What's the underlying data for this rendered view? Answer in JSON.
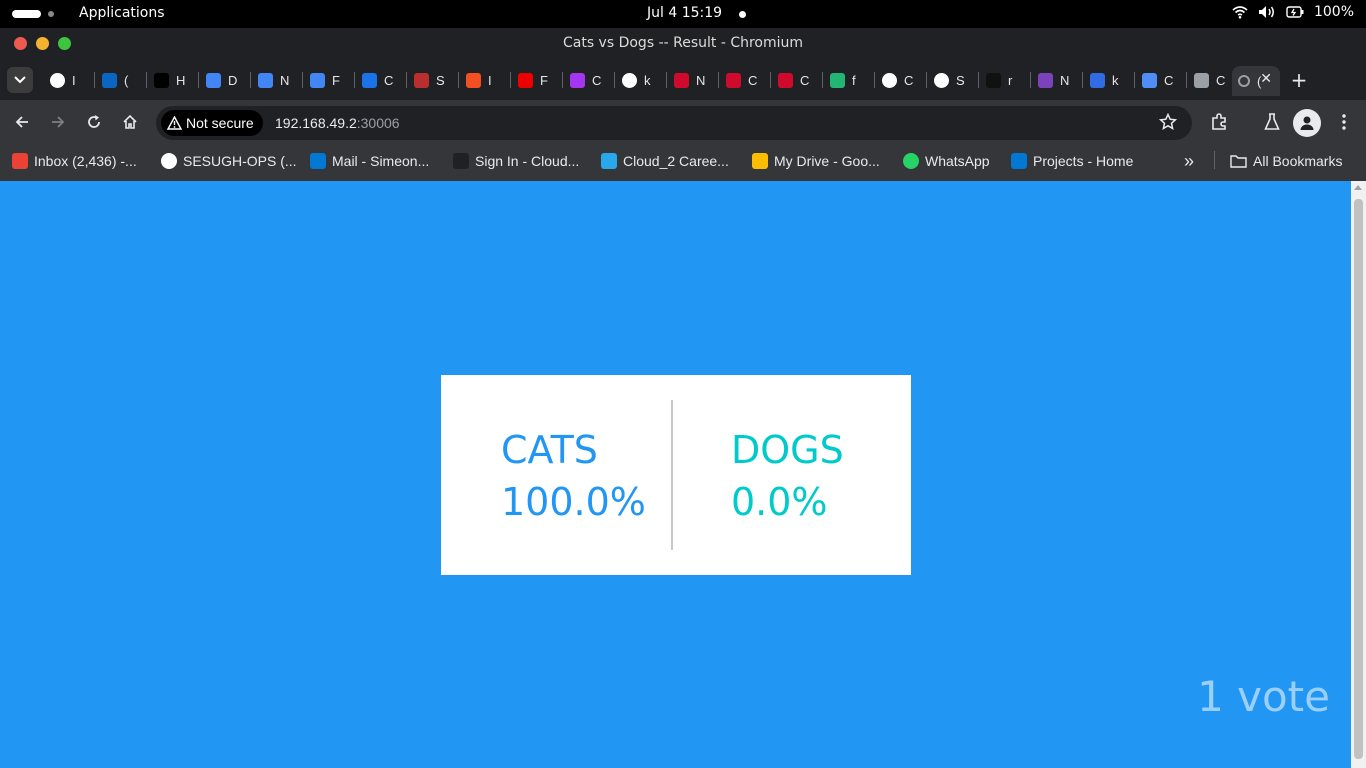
{
  "system_bar": {
    "activities_label": "Applications",
    "clock": "Jul 4  15:19",
    "battery": "100%"
  },
  "window": {
    "title": "Cats vs Dogs -- Result - Chromium"
  },
  "tabs": [
    {
      "label": "I",
      "icon": "gmail-icon",
      "color": "#ffffff"
    },
    {
      "label": "(",
      "icon": "linkedin-icon",
      "color": "#0a66c2"
    },
    {
      "label": "H",
      "icon": "x-icon",
      "color": "#000000"
    },
    {
      "label": "D",
      "icon": "google-docs-icon",
      "color": "#4285f4"
    },
    {
      "label": "N",
      "icon": "google-docs-icon",
      "color": "#4285f4"
    },
    {
      "label": "F",
      "icon": "google-docs-icon",
      "color": "#4285f4"
    },
    {
      "label": "C",
      "icon": "infinity-icon",
      "color": "#1a73e8"
    },
    {
      "label": "S",
      "icon": "scribd-icon",
      "color": "#b92e2e"
    },
    {
      "label": "I",
      "icon": "microsoft-icon",
      "color": "#f25022"
    },
    {
      "label": "F",
      "icon": "redhat-icon",
      "color": "#ee0000"
    },
    {
      "label": "C",
      "icon": "udemy-icon",
      "color": "#a435f0"
    },
    {
      "label": "k",
      "icon": "github-icon",
      "color": "#ffffff"
    },
    {
      "label": "N",
      "icon": "huawei-icon",
      "color": "#cf0a2c"
    },
    {
      "label": "C",
      "icon": "huawei-icon",
      "color": "#cf0a2c"
    },
    {
      "label": "C",
      "icon": "huawei-icon",
      "color": "#cf0a2c"
    },
    {
      "label": "f",
      "icon": "fi-icon",
      "color": "#22b573"
    },
    {
      "label": "C",
      "icon": "openai-icon",
      "color": "#ffffff"
    },
    {
      "label": "S",
      "icon": "github-icon",
      "color": "#ffffff"
    },
    {
      "label": "r",
      "icon": "dark-icon",
      "color": "#111111"
    },
    {
      "label": "N",
      "icon": "cube-icon",
      "color": "#7b42bc"
    },
    {
      "label": "k",
      "icon": "circle-logo-icon",
      "color": "#326ce5"
    },
    {
      "label": "C",
      "icon": "gemini-icon",
      "color": "#4f8ef7"
    },
    {
      "label": "C",
      "icon": "globe-icon",
      "color": "#9aa0a6"
    }
  ],
  "active_tab": {
    "label": "(",
    "close": "✕"
  },
  "toolbar": {
    "security_label": "Not secure",
    "url_host": "192.168.49.2",
    "url_port": ":30006"
  },
  "bookmarks": [
    {
      "label": "Inbox (2,436) -...",
      "icon": "gmail-icon"
    },
    {
      "label": "SESUGH-OPS (...",
      "icon": "github-icon"
    },
    {
      "label": "Mail - Simeon...",
      "icon": "outlook-icon"
    },
    {
      "label": "Sign In - Cloud...",
      "icon": "cloud-icon"
    },
    {
      "label": "Cloud_2 Caree...",
      "icon": "onedrive-icon"
    },
    {
      "label": "My Drive - Goo...",
      "icon": "google-drive-icon"
    },
    {
      "label": "WhatsApp",
      "icon": "whatsapp-icon"
    },
    {
      "label": "Projects - Home",
      "icon": "azure-devops-icon"
    }
  ],
  "bookmarks_more": "»",
  "all_bookmarks": "All Bookmarks",
  "result": {
    "cats_label": "CATS",
    "cats_percent": "100.0%",
    "dogs_label": "DOGS",
    "dogs_percent": "0.0%",
    "votes": "1 vote",
    "cats_color": "#2196f3",
    "dogs_color": "#00cbca",
    "background": "#2196f3"
  }
}
